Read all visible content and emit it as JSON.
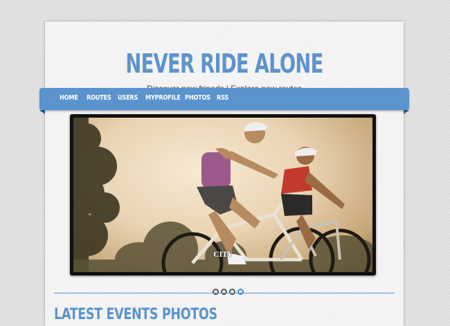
{
  "header": {
    "title": "NEVER RIDE ALONE",
    "tagline": "Discover new frineds | Explore new routes"
  },
  "nav": {
    "items": [
      {
        "label": "HOME"
      },
      {
        "label": "ROUTES"
      },
      {
        "label": "USERS"
      },
      {
        "label": "MYPROFILE"
      },
      {
        "label": "PHOTOS"
      },
      {
        "label": "RSS"
      }
    ]
  },
  "slider": {
    "caption": "CITY",
    "slide_count": 4,
    "active_index": 3
  },
  "section": {
    "title": "LATEST EVENTS PHOTOS"
  },
  "colors": {
    "accent": "#5a93cd",
    "title": "#5e93cc",
    "active_dot": "#3c8ed6"
  },
  "icons": [
    "slide-dot-icon"
  ]
}
